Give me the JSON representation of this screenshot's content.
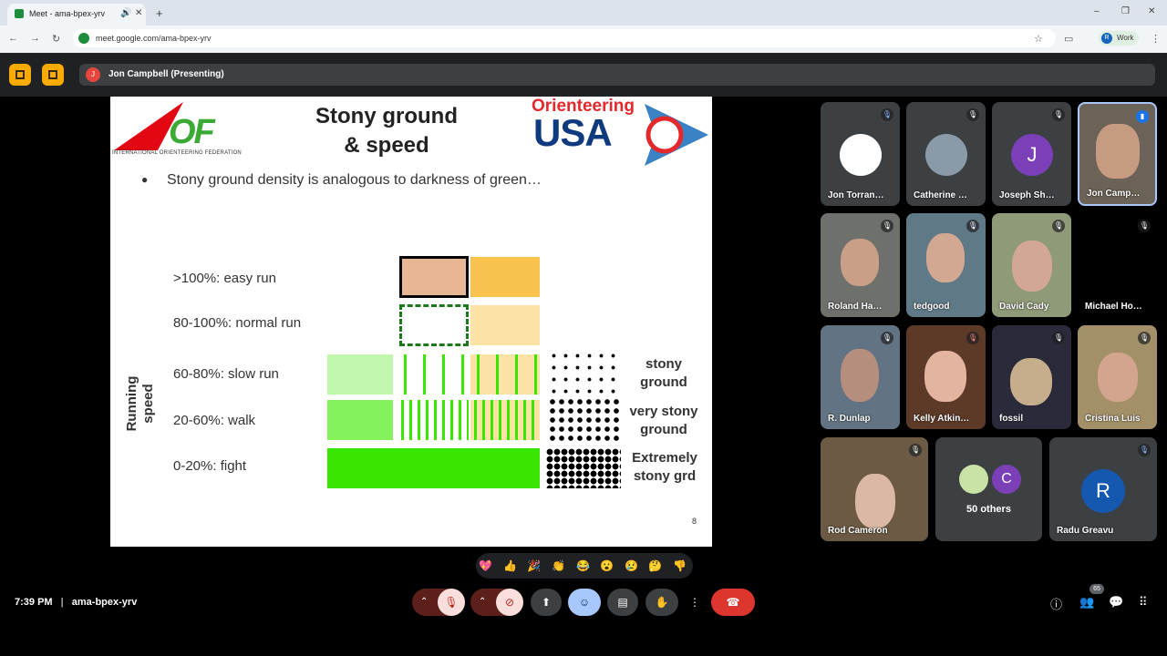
{
  "browser": {
    "tab_title": "Meet - ama-bpex-yrv",
    "url": "meet.google.com/ama-bpex-yrv",
    "profile_label": "Work",
    "profile_initial": "R"
  },
  "meet": {
    "presenter_label": "Jon Campbell (Presenting)",
    "presenter_initial": "J",
    "time": "7:39 PM",
    "meeting_code": "ama-bpex-yrv",
    "people_count": "65"
  },
  "slide": {
    "title_line1": "Stony ground",
    "title_line2": "& speed",
    "iof_logo_letters": "OF",
    "iof_caption": "INTERNATIONAL ORIENTEERING FEDERATION",
    "usa_logo_top": "Orienteering",
    "usa_logo_main": "USA",
    "bullet": "Stony ground density is analogous to darkness of green…",
    "axis_label_1": "Running",
    "axis_label_2": "speed",
    "rows": [
      {
        "label": ">100%: easy run"
      },
      {
        "label": "80-100%: normal run"
      },
      {
        "label": "60-80%: slow run"
      },
      {
        "label": "20-60%: walk"
      },
      {
        "label": "0-20%: fight"
      }
    ],
    "stony_labels": [
      {
        "line1": "stony",
        "line2": "ground"
      },
      {
        "line1": "very stony",
        "line2": "ground"
      },
      {
        "line1": "Extremely",
        "line2": "stony grd"
      }
    ],
    "page_number": "8",
    "colors": {
      "green": "#39e600",
      "light_green": "#c2f7ae",
      "mid_green": "#86f25b",
      "tan": "#e8b595",
      "yellow": "#f7c34e",
      "pale_yellow": "#fde2a6"
    }
  },
  "participants": [
    {
      "name": "Jon Torran…",
      "muted": true
    },
    {
      "name": "Catherine …",
      "muted": true
    },
    {
      "name": "Joseph Sh…",
      "initial": "J",
      "muted": true
    },
    {
      "name": "Jon Camp…",
      "speaking": true
    },
    {
      "name": "Roland Ha…",
      "muted": true
    },
    {
      "name": "tedgood",
      "muted": true
    },
    {
      "name": "David Cady",
      "muted": true
    },
    {
      "name": "Michael Ho…",
      "muted": true
    },
    {
      "name": "R. Dunlap",
      "muted": true
    },
    {
      "name": "Kelly Atkin…",
      "muted": true
    },
    {
      "name": "fossil",
      "muted": true
    },
    {
      "name": "Cristina Luis",
      "muted": true
    },
    {
      "name": "Rod Cameron",
      "muted": true
    },
    {
      "name": "50 others",
      "initial": "C"
    },
    {
      "name": "Radu Greavu",
      "initial": "R",
      "muted": true
    }
  ],
  "reactions": [
    "💖",
    "👍",
    "🎉",
    "👏",
    "😂",
    "😮",
    "😢",
    "🤔",
    "👎"
  ]
}
